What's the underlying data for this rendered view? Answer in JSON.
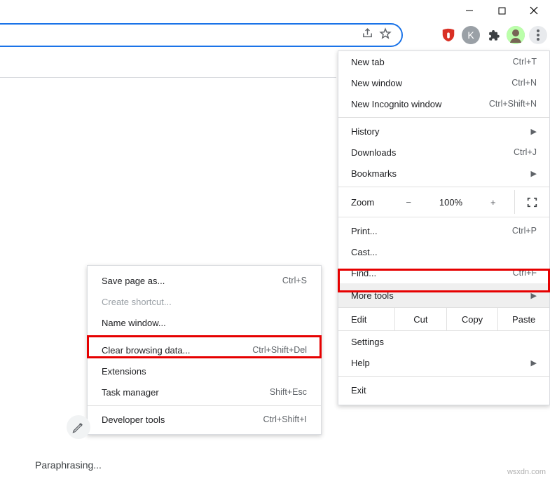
{
  "window_controls": {
    "min": "—",
    "max": "▢",
    "close": "✕"
  },
  "omnibox": {
    "share_icon": "share-icon",
    "star_icon": "star-icon"
  },
  "extensions": {
    "red": "U",
    "k": "K"
  },
  "menu": {
    "new_tab": {
      "label": "New tab",
      "shortcut": "Ctrl+T"
    },
    "new_window": {
      "label": "New window",
      "shortcut": "Ctrl+N"
    },
    "incognito": {
      "label": "New Incognito window",
      "shortcut": "Ctrl+Shift+N"
    },
    "history": {
      "label": "History"
    },
    "downloads": {
      "label": "Downloads",
      "shortcut": "Ctrl+J"
    },
    "bookmarks": {
      "label": "Bookmarks"
    },
    "zoom": {
      "label": "Zoom",
      "value": "100%"
    },
    "print": {
      "label": "Print...",
      "shortcut": "Ctrl+P"
    },
    "cast": {
      "label": "Cast..."
    },
    "find": {
      "label": "Find...",
      "shortcut": "Ctrl+F"
    },
    "more_tools": {
      "label": "More tools"
    },
    "edit": {
      "label": "Edit",
      "cut": "Cut",
      "copy": "Copy",
      "paste": "Paste"
    },
    "settings": {
      "label": "Settings"
    },
    "help": {
      "label": "Help"
    },
    "exit": {
      "label": "Exit"
    }
  },
  "submenu": {
    "save_page": {
      "label": "Save page as...",
      "shortcut": "Ctrl+S"
    },
    "create_sc": {
      "label": "Create shortcut..."
    },
    "name_win": {
      "label": "Name window..."
    },
    "clear_data": {
      "label": "Clear browsing data...",
      "shortcut": "Ctrl+Shift+Del"
    },
    "extensions": {
      "label": "Extensions"
    },
    "task_mgr": {
      "label": "Task manager",
      "shortcut": "Shift+Esc"
    },
    "dev_tools": {
      "label": "Developer tools",
      "shortcut": "Ctrl+Shift+I"
    }
  },
  "footer": {
    "paraphrasing": "Paraphrasing...",
    "watermark": "wsxdn.com"
  }
}
